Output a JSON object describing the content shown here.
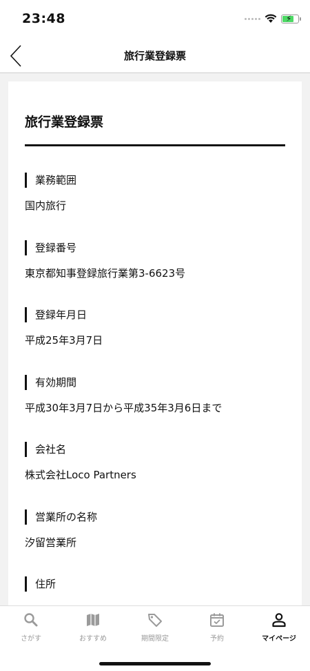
{
  "status_bar": {
    "time": "23:48"
  },
  "nav": {
    "title": "旅行業登録票"
  },
  "card": {
    "title": "旅行業登録票",
    "sections": [
      {
        "label": "業務範囲",
        "value": "国内旅行"
      },
      {
        "label": "登録番号",
        "value": "東京都知事登録旅行業第3-6623号"
      },
      {
        "label": "登録年月日",
        "value": "平成25年3月7日"
      },
      {
        "label": "有効期間",
        "value": "平成30年3月7日から平成35年3月6日まで"
      },
      {
        "label": "会社名",
        "value": "株式会社Loco Partners"
      },
      {
        "label": "営業所の名称",
        "value": "汐留営業所"
      },
      {
        "label": "住所",
        "value": ""
      }
    ]
  },
  "tabs": [
    {
      "label": "さがす",
      "icon": "search-icon"
    },
    {
      "label": "おすすめ",
      "icon": "map-icon"
    },
    {
      "label": "期間限定",
      "icon": "tag-icon"
    },
    {
      "label": "予約",
      "icon": "calendar-check-icon"
    },
    {
      "label": "マイページ",
      "icon": "person-icon",
      "active": true
    }
  ],
  "colors": {
    "active": "#111111",
    "inactive": "#9a9a9a",
    "battery": "#4cd964"
  }
}
